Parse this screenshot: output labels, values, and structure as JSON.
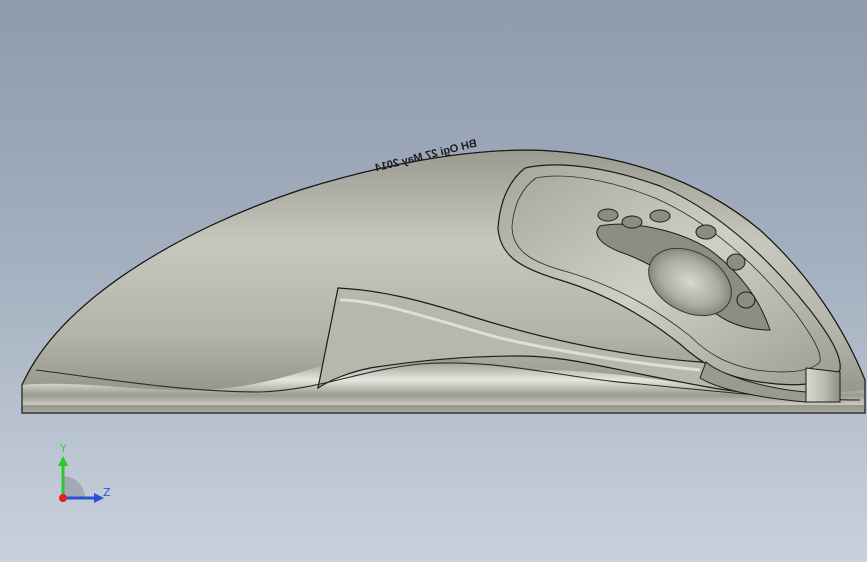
{
  "viewport": {
    "background_top": "#8f9bad",
    "background_bottom": "#c9d1dc"
  },
  "model": {
    "engraved_text": "BH Ogi 27 May 2014",
    "body_color": "#c9c9bf",
    "edge_color": "#1c1c1c",
    "wheel_icon": "scroll-wheel-icon"
  },
  "triad": {
    "y_label": "Y",
    "z_label": "Z",
    "y_color": "#31c431",
    "z_color": "#2a52d6",
    "x_color": "#e02020"
  }
}
